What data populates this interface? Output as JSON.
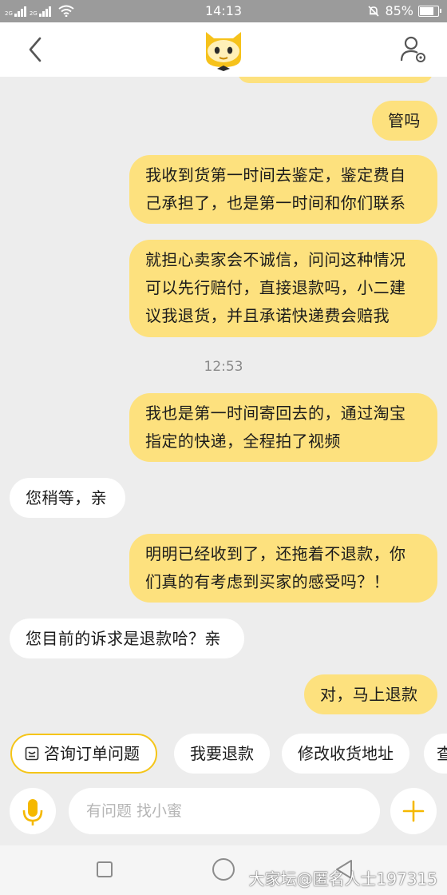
{
  "status_bar": {
    "network_1": "2G",
    "network_2": "2G",
    "time": "14:13",
    "battery": "85%",
    "battery_level": 0.85
  },
  "header": {
    "back_icon": "chevron-left-icon",
    "mascot_icon": "owl-mascot-icon",
    "profile_icon": "user-settings-icon"
  },
  "messages": [
    {
      "side": "out",
      "text_lines": [
        "管吗"
      ]
    },
    {
      "side": "out",
      "text_lines": [
        "我收到货第一时间去鉴定，鉴定费自",
        "己承担了，也是第一时间和你们联系"
      ]
    },
    {
      "side": "out",
      "text_lines": [
        "就担心卖家会不诚信，问问这种情况",
        "可以先行赔付，直接退款吗，小二建",
        "议我退货，并且承诺快递费会赔我"
      ]
    },
    {
      "timestamp": "12:53"
    },
    {
      "side": "out",
      "text_lines": [
        "我也是第一时间寄回去的，通过淘宝",
        "指定的快递，全程拍了视频"
      ]
    },
    {
      "side": "in",
      "text_lines": [
        "您稍等，亲"
      ]
    },
    {
      "side": "out",
      "text_lines": [
        "明明已经收到了，还拖着不退款，你",
        "们真的有考虑到买家的感受吗？！"
      ]
    },
    {
      "side": "in",
      "text_lines": [
        "您目前的诉求是退款哈？亲"
      ]
    },
    {
      "side": "out",
      "text_lines": [
        "对，马上退款"
      ]
    }
  ],
  "quick_replies": [
    {
      "label": "咨询订单问题",
      "icon": "order-icon"
    },
    {
      "label": "我要退款"
    },
    {
      "label": "修改收货地址"
    },
    {
      "label": "查"
    }
  ],
  "input": {
    "placeholder": "有问题 找小蜜",
    "mic_icon": "microphone-icon",
    "plus_icon": "plus-icon"
  },
  "watermark": "大家坛@匿名人士197315",
  "colors": {
    "outgoing_bubble": "#fde17e",
    "incoming_bubble": "#ffffff",
    "accent": "#f5c518",
    "background": "#ededed"
  }
}
